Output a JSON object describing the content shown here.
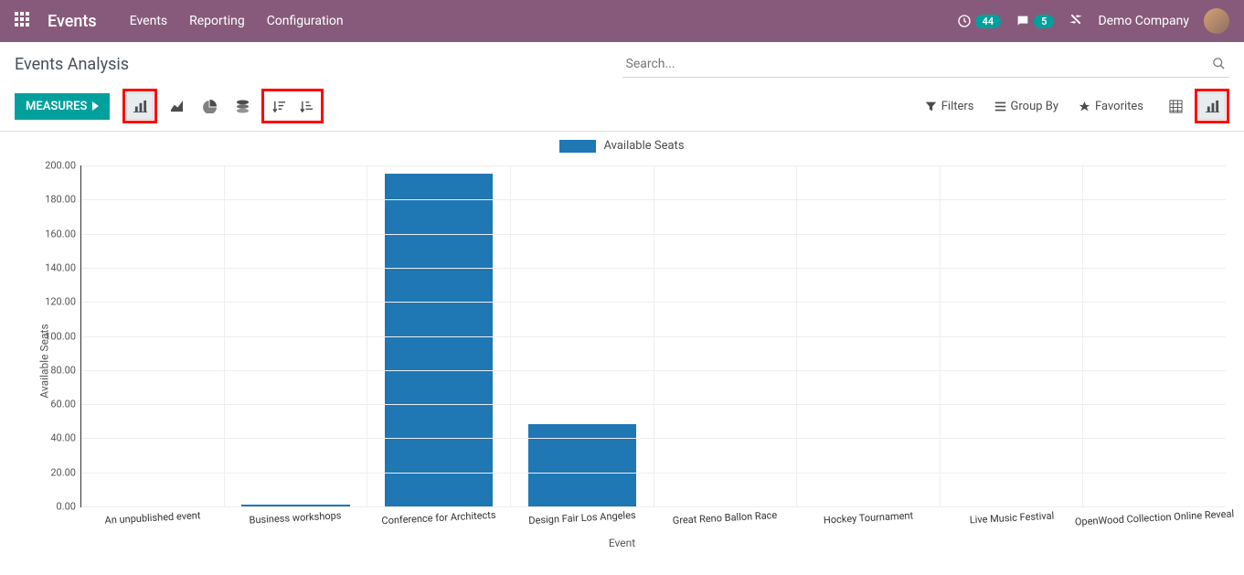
{
  "navbar": {
    "brand": "Events",
    "menu": [
      "Events",
      "Reporting",
      "Configuration"
    ],
    "clock_badge": "44",
    "chat_badge": "5",
    "company": "Demo Company"
  },
  "breadcrumb": "Events Analysis",
  "search": {
    "placeholder": "Search..."
  },
  "toolbar": {
    "measures": "MEASURES",
    "filters": "Filters",
    "groupby": "Group By",
    "favorites": "Favorites"
  },
  "legend": "Available Seats",
  "y_axis_title": "Available Seats",
  "x_axis_title": "Event",
  "chart_data": {
    "type": "bar",
    "title": "",
    "xlabel": "Event",
    "ylabel": "Available Seats",
    "ylim": [
      0,
      200
    ],
    "y_ticks": [
      "0.00",
      "20.00",
      "40.00",
      "60.00",
      "80.00",
      "100.00",
      "120.00",
      "140.00",
      "160.00",
      "180.00",
      "200.00"
    ],
    "categories": [
      "An unpublished event",
      "Business workshops",
      "Conference for Architects",
      "Design Fair Los Angeles",
      "Great Reno Ballon Race",
      "Hockey Tournament",
      "Live Music Festival",
      "OpenWood Collection Online Reveal"
    ],
    "values": [
      0,
      1,
      195,
      48,
      0,
      0,
      0,
      0
    ],
    "series": [
      {
        "name": "Available Seats",
        "values": [
          0,
          1,
          195,
          48,
          0,
          0,
          0,
          0
        ]
      }
    ]
  }
}
